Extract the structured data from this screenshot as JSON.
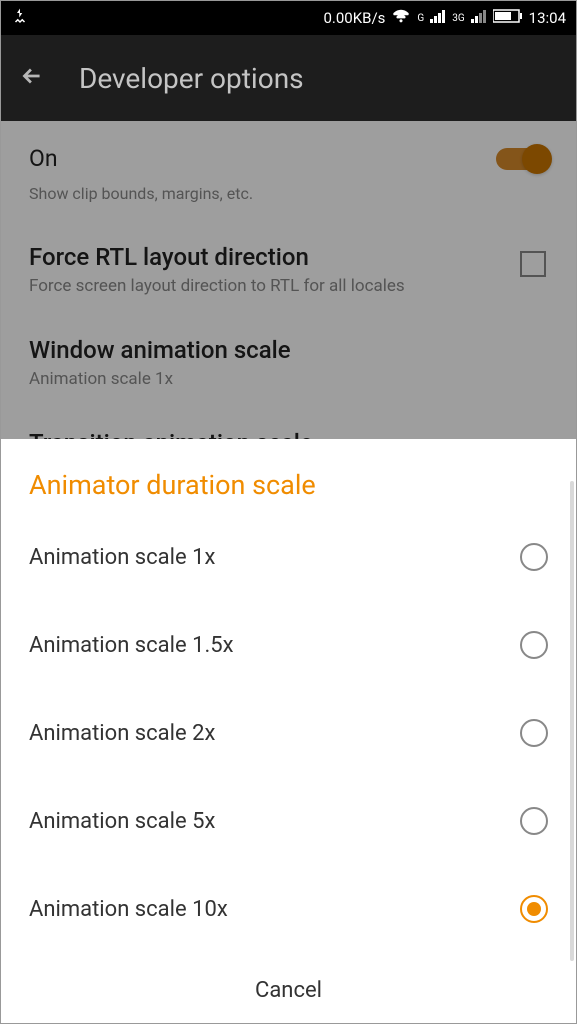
{
  "status": {
    "data_rate": "0.00KB/s",
    "network_g": "G",
    "network_3g": "3G",
    "time": "13:04"
  },
  "header": {
    "title": "Developer options"
  },
  "settings": {
    "on_label": "On",
    "clip_desc": "Show clip bounds, margins, etc.",
    "rtl_title": "Force RTL layout direction",
    "rtl_desc": "Force screen layout direction to RTL for all locales",
    "window_title": "Window animation scale",
    "window_desc": "Animation scale 1x",
    "transition_title": "Transition animation scale"
  },
  "dialog": {
    "title": "Animator duration scale",
    "options": [
      {
        "label": "Animation scale 1x",
        "selected": false
      },
      {
        "label": "Animation scale 1.5x",
        "selected": false
      },
      {
        "label": "Animation scale 2x",
        "selected": false
      },
      {
        "label": "Animation scale 5x",
        "selected": false
      },
      {
        "label": "Animation scale 10x",
        "selected": true
      }
    ],
    "cancel": "Cancel"
  }
}
